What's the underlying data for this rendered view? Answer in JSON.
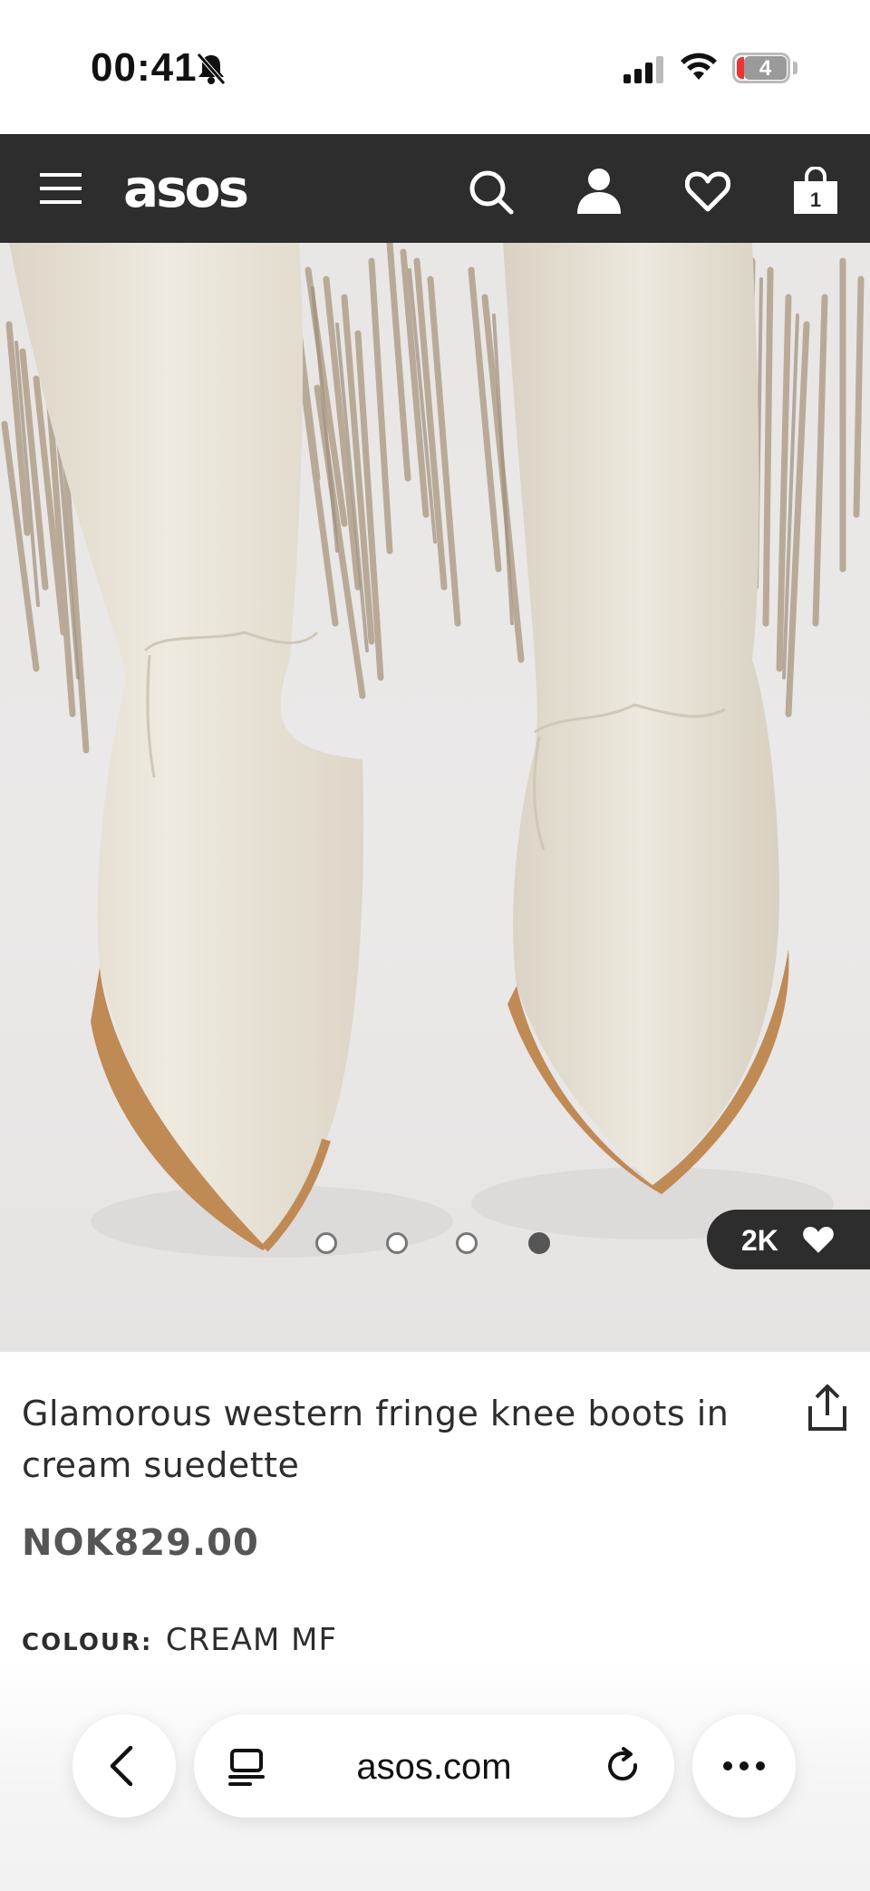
{
  "status_bar": {
    "time": "00:41",
    "battery": "4",
    "icons": [
      "bell-slash-icon",
      "signal-icon",
      "wifi-icon",
      "battery-icon"
    ]
  },
  "nav": {
    "logo": "asos",
    "icons": [
      "menu-icon",
      "search-icon",
      "account-icon",
      "wishlist-heart-icon",
      "bag-icon"
    ],
    "bag_count": "1"
  },
  "product": {
    "gallery": {
      "image_description": "cream suedette western knee boots with fringe",
      "slide_count": 4,
      "active_slide": 4,
      "saves_count": "2K"
    },
    "title": "Glamorous western fringe knee boots in cream suedette",
    "price": "NOK829.00",
    "colour_label": "COLOUR:",
    "colour_value": "CREAM MF"
  },
  "browser_bar": {
    "url": "asos.com",
    "icons": [
      "back-chevron-icon",
      "tabs-icon",
      "reload-icon",
      "more-icon"
    ]
  },
  "colors": {
    "nav_bg": "#2d2d2d",
    "text": "#2d2d2d",
    "price": "#555555",
    "boot_cream": "#eae4d8",
    "sole_tan": "#c08a55",
    "fringe": "#b6a793"
  }
}
